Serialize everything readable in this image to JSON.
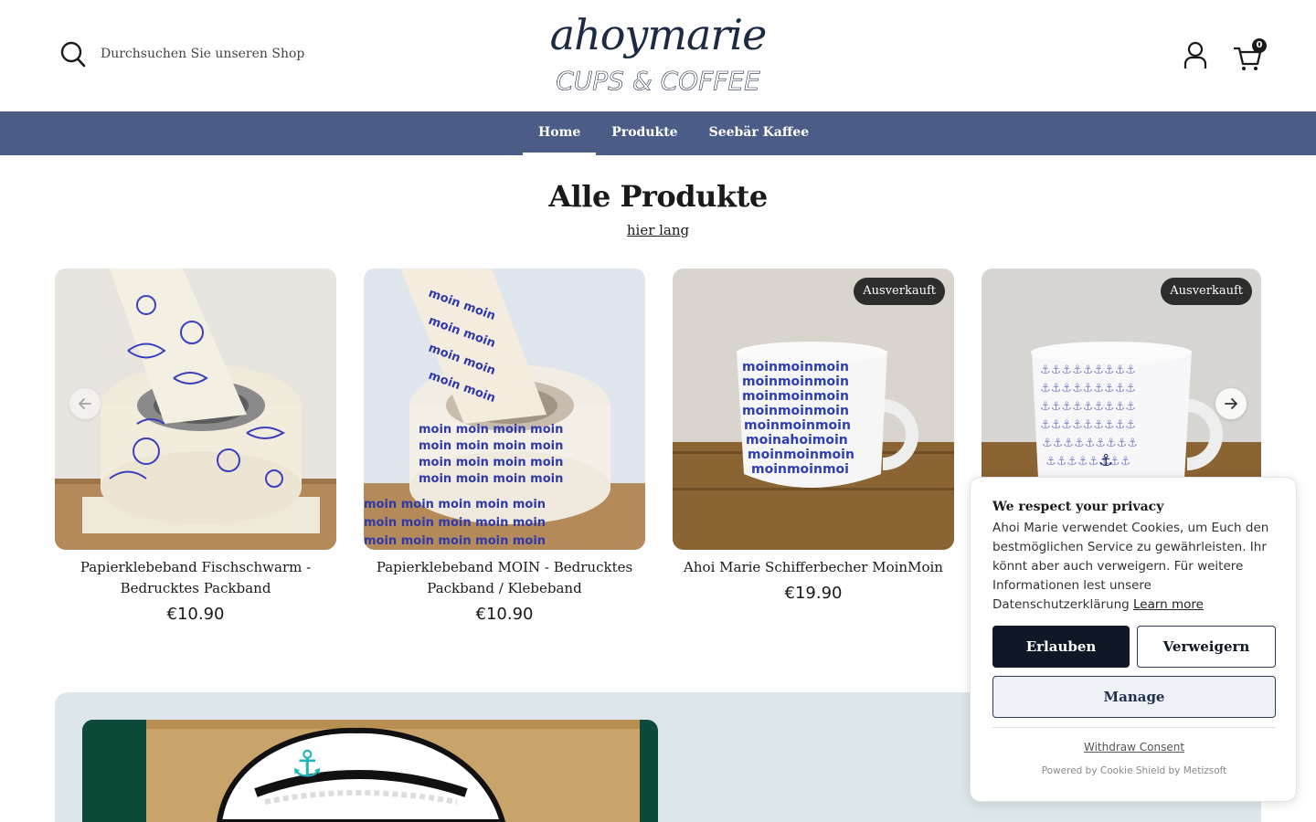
{
  "header": {
    "search_placeholder": "Durchsuchen Sie unseren Shop",
    "logo": {
      "line1": "ahoymarie",
      "line2": "CUPS & COFFEE"
    },
    "cart_count": "0"
  },
  "nav": {
    "items": [
      {
        "label": "Home",
        "active": true
      },
      {
        "label": "Produkte",
        "active": false
      },
      {
        "label": "Seebär Kaffee",
        "active": false
      }
    ]
  },
  "section": {
    "title": "Alle Produkte",
    "link": "hier lang"
  },
  "products": [
    {
      "title": "Papierklebeband Fischschwarm - Bedrucktes Packband",
      "price": "€10.90",
      "badge": ""
    },
    {
      "title": "Papierklebeband MOIN - Bedrucktes Packband / Klebeband",
      "price": "€10.90",
      "badge": ""
    },
    {
      "title": "Ahoi Marie Schifferbecher MoinMoin",
      "price": "€19.90",
      "badge": "Ausverkauft"
    },
    {
      "title": "",
      "price": "",
      "badge": "Ausverkauft"
    }
  ],
  "cookie": {
    "title": "We respect your privacy",
    "text": "Ahoi Marie verwendet Cookies, um Euch den bestmöglichen Service zu gewährleisten. Ihr könnt aber auch verweigern. Für weitere Informationen lest unsere Datenschutzerklärung",
    "learn_more": "Learn more",
    "allow": "Erlauben",
    "deny": "Verweigern",
    "manage": "Manage",
    "withdraw": "Withdraw Consent",
    "powered": "Powered by Cookie Shield by Metizsoft"
  },
  "colors": {
    "nav_bg": "#4b5d87",
    "accent_dark": "#101828",
    "feature_bg": "#dde6ea",
    "badge_bg": "#2d2d2d"
  },
  "icons": [
    "search-icon",
    "account-icon",
    "cart-icon",
    "arrow-left-icon",
    "arrow-right-icon"
  ]
}
